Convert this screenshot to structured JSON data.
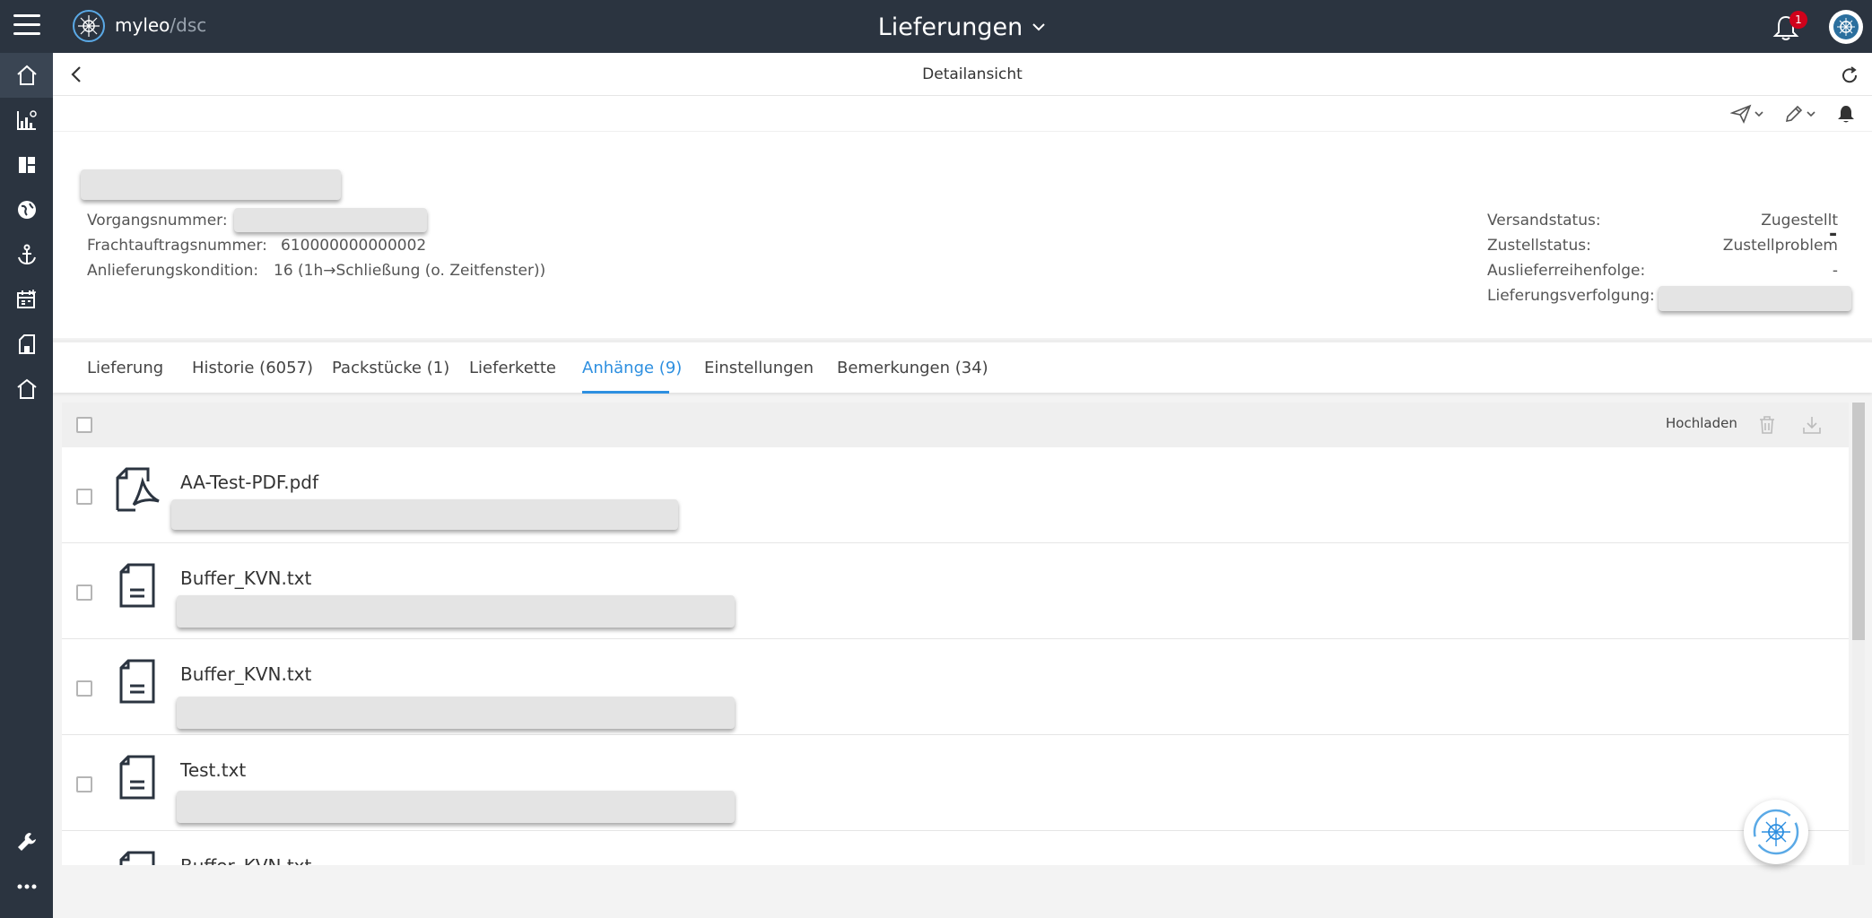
{
  "header": {
    "logo_text": "myleo",
    "logo_slash": "/",
    "logo_suffix": "dsc",
    "title": "Lieferungen",
    "notification_count": "1"
  },
  "sidebar": {
    "items": [
      {
        "icon": "home-icon"
      },
      {
        "icon": "chart-icon"
      },
      {
        "icon": "dashboard-icon"
      },
      {
        "icon": "globe-icon"
      },
      {
        "icon": "anchor-icon"
      },
      {
        "icon": "calendar-icon"
      },
      {
        "icon": "document-icon"
      },
      {
        "icon": "warehouse-icon"
      }
    ],
    "bottom": [
      {
        "icon": "wrench-icon"
      },
      {
        "icon": "more-icon"
      }
    ]
  },
  "detail": {
    "title": "Detailansicht"
  },
  "info": {
    "left": [
      {
        "label": "Vorgangsnummer:",
        "value": ""
      },
      {
        "label": "Frachtauftragsnummer:",
        "value": "610000000000002"
      },
      {
        "label": "Anlieferungskondition:",
        "value": "16 (1h→Schließung (o. Zeitfenster))"
      }
    ],
    "right_top": "-",
    "right": [
      {
        "label": "Versandstatus:",
        "value": "Zugestellt"
      },
      {
        "label": "Zustellstatus:",
        "value": "Zustellproblem"
      },
      {
        "label": "Auslieferreihenfolge:",
        "value": "-"
      },
      {
        "label": "Lieferungsverfolgung:",
        "value": ""
      }
    ]
  },
  "tabs": [
    {
      "label": "Lieferung"
    },
    {
      "label": "Historie (6057)"
    },
    {
      "label": "Packstücke (1)"
    },
    {
      "label": "Lieferkette"
    },
    {
      "label": "Anhänge (9)"
    },
    {
      "label": "Einstellungen"
    },
    {
      "label": "Bemerkungen (34)"
    }
  ],
  "active_tab": "Anhänge (9)",
  "toolbar": {
    "upload_label": "Hochladen"
  },
  "attachments": [
    {
      "name": "AA-Test-PDF.pdf",
      "type": "pdf-file-icon"
    },
    {
      "name": "Buffer_KVN.txt",
      "type": "text-file-icon"
    },
    {
      "name": "Buffer_KVN.txt",
      "type": "text-file-icon"
    },
    {
      "name": "Test.txt",
      "type": "text-file-icon"
    },
    {
      "name": "Buffer_KVN.txt",
      "type": "text-file-icon"
    }
  ],
  "colors": {
    "topbar": "#2b3440",
    "accent": "#2d8fe0",
    "badge": "#d0021b"
  }
}
